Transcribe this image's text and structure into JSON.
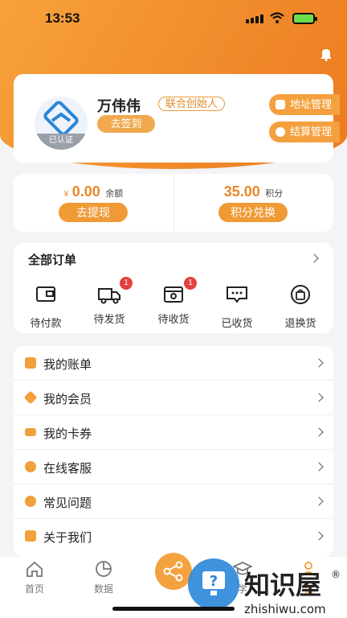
{
  "status_bar": {
    "time": "13:53"
  },
  "profile": {
    "name": "万伟伟",
    "role": "联合创始人",
    "verified": "已认证",
    "signin": "去签到",
    "address_btn": "地址管理",
    "settle_btn": "结算管理"
  },
  "wallet": {
    "balance": {
      "currency": "¥",
      "value": "0.00",
      "unit": "余额",
      "action": "去提现"
    },
    "points": {
      "value": "35.00",
      "unit": "积分",
      "action": "积分兑换"
    }
  },
  "orders": {
    "title": "全部订单",
    "items": [
      {
        "label": "待付款",
        "icon": "wallet-icon",
        "badge": ""
      },
      {
        "label": "待发货",
        "icon": "truck-icon",
        "badge": "1"
      },
      {
        "label": "待收货",
        "icon": "box-icon",
        "badge": "1"
      },
      {
        "label": "已收货",
        "icon": "chat-icon",
        "badge": ""
      },
      {
        "label": "退换货",
        "icon": "bag-icon",
        "badge": ""
      }
    ]
  },
  "menu": [
    {
      "label": "我的账单",
      "icon": "bill-icon"
    },
    {
      "label": "我的会员",
      "icon": "diamond-icon"
    },
    {
      "label": "我的卡券",
      "icon": "ticket-icon"
    },
    {
      "label": "在线客服",
      "icon": "support-icon"
    },
    {
      "label": "常见问题",
      "icon": "question-icon"
    },
    {
      "label": "关于我们",
      "icon": "edit-icon"
    }
  ],
  "tabbar": {
    "items": [
      {
        "label": "首页",
        "icon": "home-icon"
      },
      {
        "label": "数据",
        "icon": "pie-icon"
      },
      {
        "label": "学",
        "icon": "cap-icon"
      },
      {
        "label": "我",
        "icon": "user-icon"
      }
    ]
  },
  "watermark": {
    "text": "知识屋",
    "url": "zhishiwu.com"
  },
  "colors": {
    "accent": "#f09a36",
    "badge": "#e34040"
  }
}
